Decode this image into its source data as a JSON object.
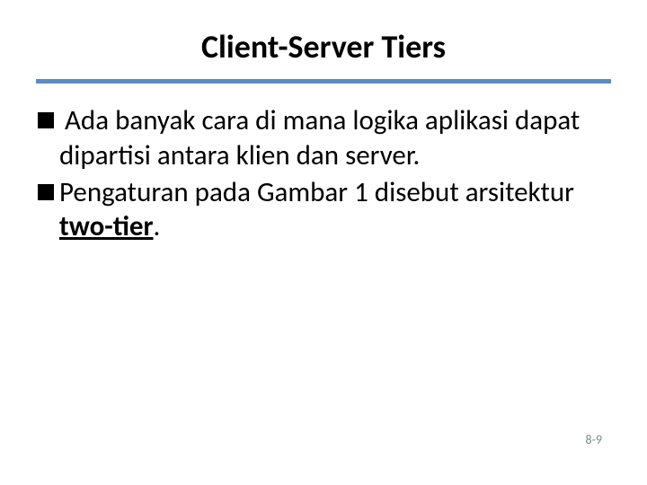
{
  "slide": {
    "title": "Client-Server Tiers",
    "bullets": [
      {
        "leading_space": " ",
        "text": "Ada banyak cara di mana logika aplikasi dapat dipartisi antara klien dan server."
      },
      {
        "text_before": "Pengaturan pada Gambar 1 disebut arsitektur ",
        "emphasis": "two-tier",
        "text_after": "."
      }
    ],
    "page_number": "8-9"
  }
}
